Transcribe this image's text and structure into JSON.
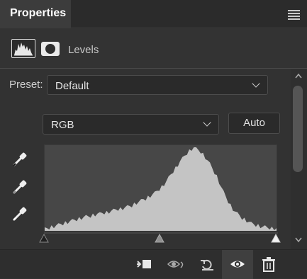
{
  "panel": {
    "title": "Properties",
    "adjustment": "Levels"
  },
  "preset": {
    "label": "Preset:",
    "value": "Default"
  },
  "channel": {
    "value": "RGB"
  },
  "auto_button": {
    "label": "Auto"
  },
  "histogram": {
    "values": [
      2,
      3,
      4,
      5,
      6,
      7,
      8,
      9,
      10,
      11,
      12,
      13,
      14,
      15,
      16,
      17,
      18,
      19,
      20,
      20,
      21,
      22,
      23,
      24,
      24,
      25,
      26,
      26,
      27,
      28,
      29,
      30,
      31,
      31,
      32,
      33,
      34,
      35,
      36,
      38,
      40,
      41,
      43,
      45,
      46,
      48,
      50,
      52,
      54,
      57,
      60,
      63,
      67,
      71,
      76,
      81,
      86,
      90,
      95,
      100,
      104,
      108,
      112,
      115,
      118,
      120,
      118,
      116,
      114,
      110,
      106,
      101,
      96,
      90,
      84,
      78,
      70,
      62,
      55,
      48,
      42,
      36,
      31,
      27,
      24,
      21,
      18,
      16,
      14,
      12,
      10,
      9,
      8,
      7,
      6,
      5,
      5,
      4,
      4,
      3,
      3,
      3
    ]
  },
  "sliders": {
    "black_point": 0,
    "midtone": 128,
    "white_point": 255
  }
}
